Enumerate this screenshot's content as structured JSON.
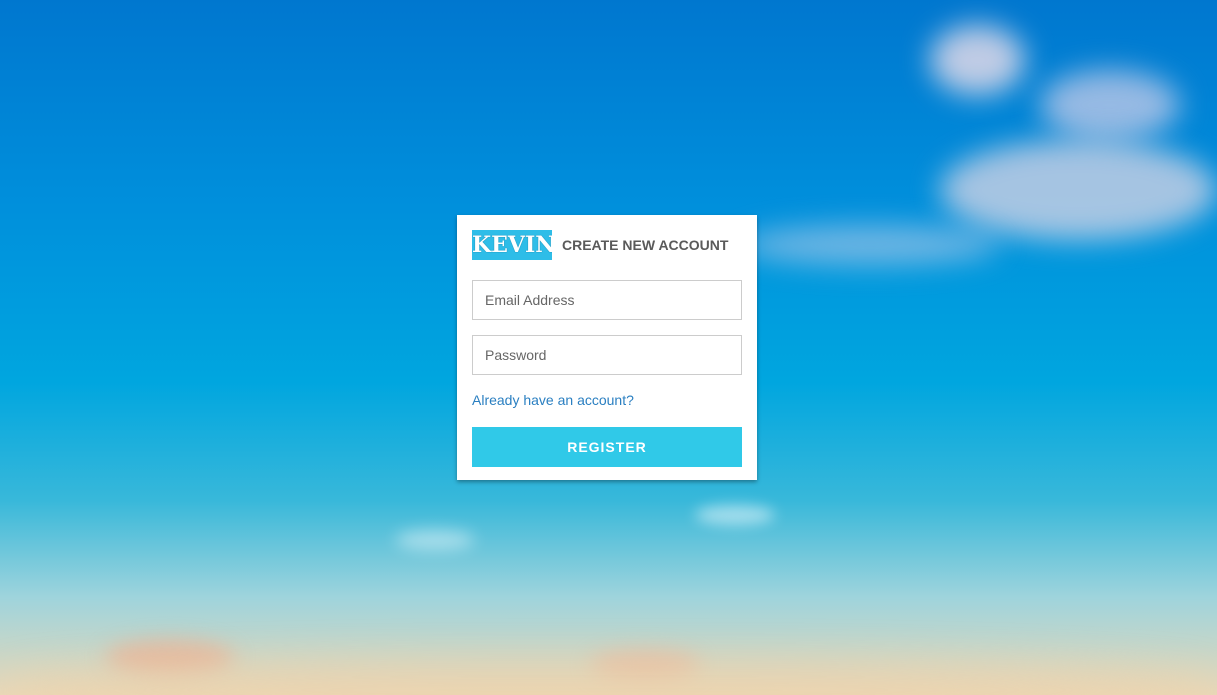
{
  "brand": {
    "logo_text": "KEVIN",
    "logo_color": "#2ebde8"
  },
  "form": {
    "title": "CREATE NEW ACCOUNT",
    "email_placeholder": "Email Address",
    "password_placeholder": "Password",
    "login_link_label": "Already have an account?",
    "register_label": "REGISTER"
  },
  "colors": {
    "accent": "#30c9e8",
    "link": "#2a7fc1",
    "card_background": "#ffffff"
  }
}
